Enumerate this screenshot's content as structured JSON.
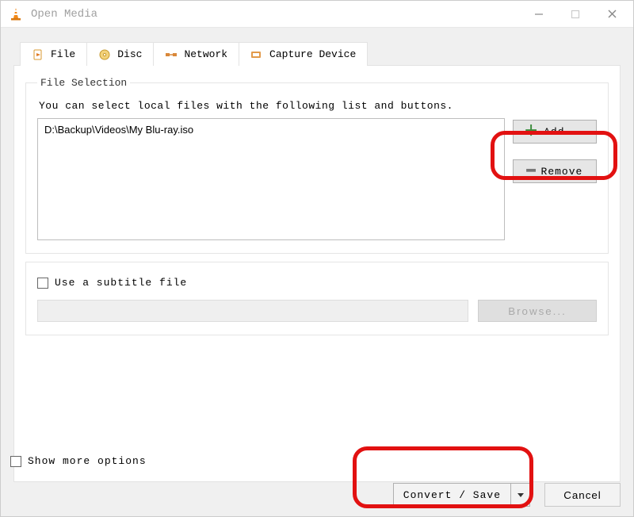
{
  "window": {
    "title": "Open Media"
  },
  "tabs": {
    "file": {
      "label": "File"
    },
    "disc": {
      "label": "Disc"
    },
    "network": {
      "label": "Network"
    },
    "capture": {
      "label": "Capture Device"
    }
  },
  "file_selection": {
    "legend": "File Selection",
    "helper": "You can select local files with the following list and buttons.",
    "files": [
      "D:\\Backup\\Videos\\My Blu-ray.iso"
    ],
    "add_label": "Add...",
    "remove_label": "Remove"
  },
  "subtitle": {
    "checkbox_label": "Use a subtitle file",
    "browse_label": "Browse..."
  },
  "more_options_label": "Show more options",
  "actions": {
    "convert_label": "Convert / Save",
    "cancel_label": "Cancel"
  },
  "icons": {
    "plus_glyph": "＋",
    "minus_glyph": "━"
  }
}
